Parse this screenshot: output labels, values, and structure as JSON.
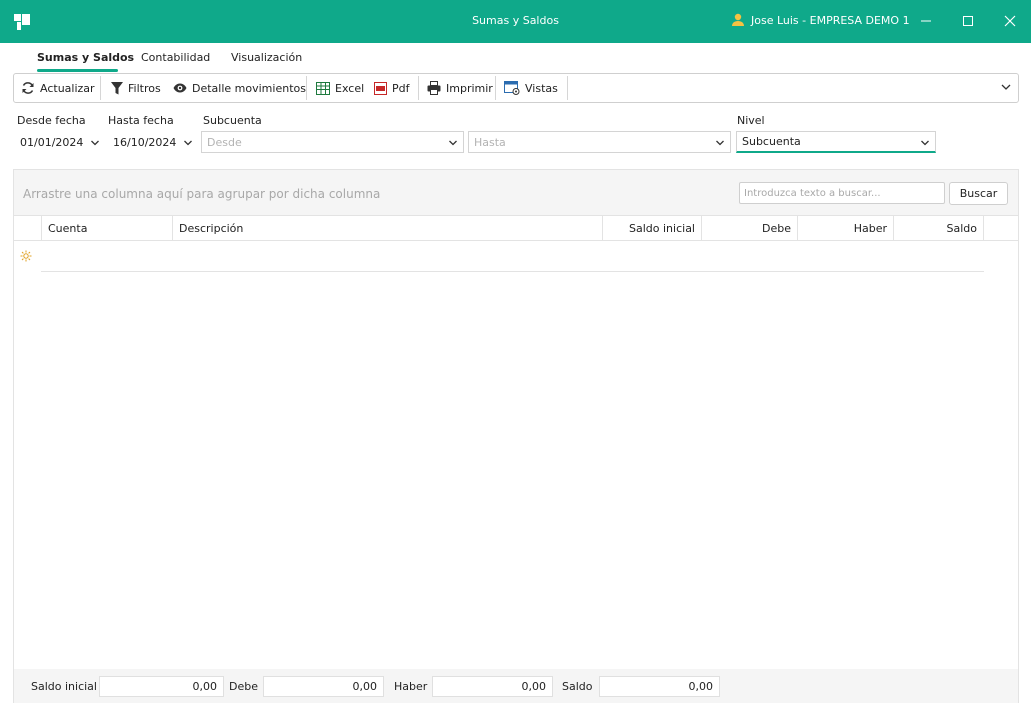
{
  "window": {
    "title": "Sumas y Saldos",
    "user": "Jose Luis - EMPRESA DEMO 1",
    "accent_color": "#0fa98a"
  },
  "tabs": [
    {
      "label": "Sumas y Saldos",
      "active": true
    },
    {
      "label": "Contabilidad",
      "active": false
    },
    {
      "label": "Visualización",
      "active": false
    }
  ],
  "toolbar": {
    "refresh": {
      "label": "Actualizar",
      "icon": "refresh-icon"
    },
    "filters": {
      "label": "Filtros",
      "icon": "filter-icon"
    },
    "details": {
      "label": "Detalle movimientos",
      "icon": "eye-icon"
    },
    "excel": {
      "label": "Excel",
      "icon": "excel-icon"
    },
    "pdf": {
      "label": "Pdf",
      "icon": "pdf-icon"
    },
    "print": {
      "label": "Imprimir",
      "icon": "printer-icon"
    },
    "views": {
      "label": "Vistas",
      "icon": "views-icon"
    }
  },
  "filters": {
    "from_date": {
      "label": "Desde fecha",
      "value": "01/01/2024"
    },
    "to_date": {
      "label": "Hasta fecha",
      "value": "16/10/2024"
    },
    "subaccount": {
      "label": "Subcuenta",
      "from_placeholder": "Desde",
      "to_placeholder": "Hasta"
    },
    "level": {
      "label": "Nivel",
      "value": "Subcuenta"
    }
  },
  "grid": {
    "group_hint": "Arrastre una columna aquí para agrupar por dicha columna",
    "search_placeholder": "Introduzca texto a buscar...",
    "search_button": "Buscar",
    "columns": [
      "Cuenta",
      "Descripción",
      "Saldo inicial",
      "Debe",
      "Haber",
      "Saldo"
    ],
    "rows": []
  },
  "totals": {
    "saldo_inicial": {
      "label": "Saldo inicial",
      "value": "0,00"
    },
    "debe": {
      "label": "Debe",
      "value": "0,00"
    },
    "haber": {
      "label": "Haber",
      "value": "0,00"
    },
    "saldo": {
      "label": "Saldo",
      "value": "0,00"
    }
  }
}
